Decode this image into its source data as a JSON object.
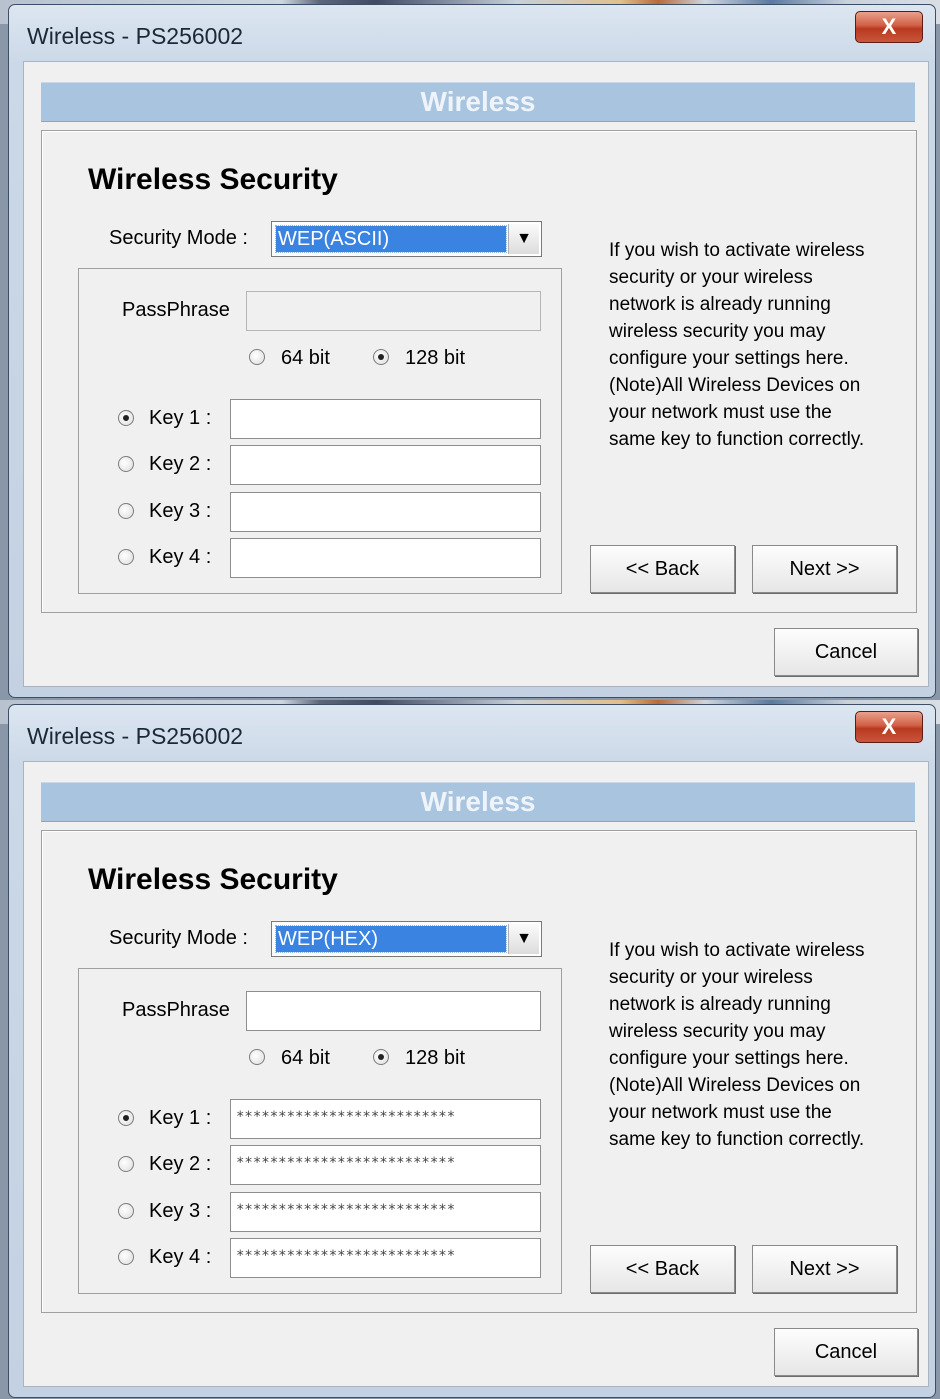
{
  "windows": [
    {
      "title": "Wireless - PS256002",
      "close_label": "X",
      "banner": "Wireless",
      "heading": "Wireless Security",
      "security_mode_label": "Security Mode :",
      "security_mode_value": "WEP(ASCII)",
      "passphrase_label": "PassPhrase",
      "passphrase_value": "",
      "bit_64_label": "64 bit",
      "bit_128_label": "128 bit",
      "selected_bits": "128 bit",
      "keys": [
        {
          "label": "Key 1 :",
          "value": "",
          "selected": true
        },
        {
          "label": "Key 2 :",
          "value": "",
          "selected": false
        },
        {
          "label": "Key 3 :",
          "value": "",
          "selected": false
        },
        {
          "label": "Key 4 :",
          "value": "",
          "selected": false
        }
      ],
      "info_lines": [
        "If you wish to activate wireless",
        "security or your wireless",
        "network is already running",
        "wireless security you may",
        "configure your settings here.",
        "(Note)All Wireless Devices on",
        "your network must use the",
        "same key to function correctly."
      ],
      "back_label": "<< Back",
      "next_label": "Next >>",
      "cancel_label": "Cancel"
    },
    {
      "title": "Wireless - PS256002",
      "close_label": "X",
      "banner": "Wireless",
      "heading": "Wireless Security",
      "security_mode_label": "Security Mode :",
      "security_mode_value": "WEP(HEX)",
      "passphrase_label": "PassPhrase",
      "passphrase_value": "",
      "bit_64_label": "64 bit",
      "bit_128_label": "128 bit",
      "selected_bits": "128 bit",
      "keys": [
        {
          "label": "Key 1 :",
          "value": "**************************",
          "selected": true
        },
        {
          "label": "Key 2 :",
          "value": "**************************",
          "selected": false
        },
        {
          "label": "Key 3 :",
          "value": "**************************",
          "selected": false
        },
        {
          "label": "Key 4 :",
          "value": "**************************",
          "selected": false
        }
      ],
      "info_lines": [
        "If you wish to activate wireless",
        "security or your wireless",
        "network is already running",
        "wireless security you may",
        "configure your settings here.",
        "(Note)All Wireless Devices on",
        "your network must use the",
        "same key to function correctly."
      ],
      "back_label": "<< Back",
      "next_label": "Next >>",
      "cancel_label": "Cancel"
    }
  ]
}
